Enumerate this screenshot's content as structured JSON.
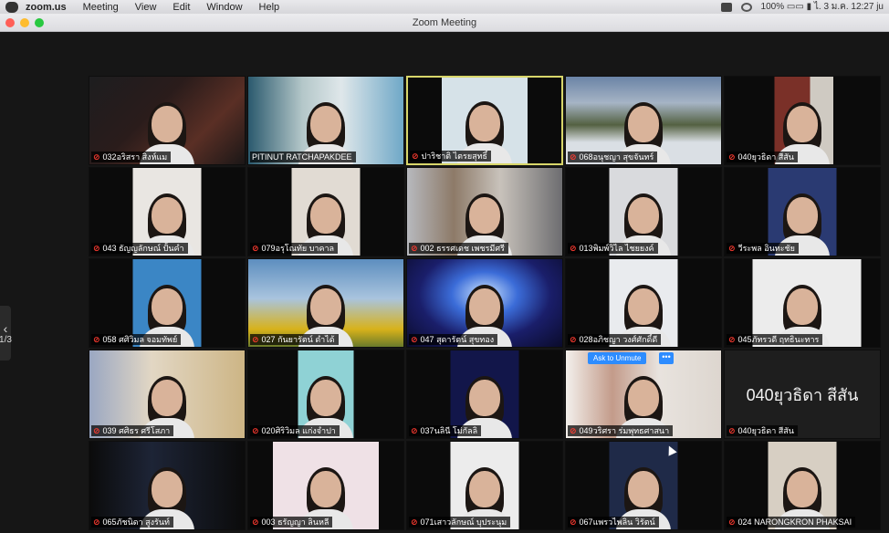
{
  "menubar": {
    "app_name": "zoom.us",
    "items": [
      "Meeting",
      "View",
      "Edit",
      "Window",
      "Help"
    ],
    "status_text": "100% ▭▭  ▮  ไ. 3 ม.ค.  12:27  ju"
  },
  "window": {
    "title": "Zoom Meeting",
    "page_indicator": "1/3"
  },
  "participants": [
    {
      "name": "032อริสรา สิงห์แม",
      "muted": true,
      "type": "video"
    },
    {
      "name": "PITINUT RATCHAPAKDEE",
      "muted": false,
      "type": "video"
    },
    {
      "name": "ปาริชาติ ไตรยสุทธิ์",
      "muted": true,
      "type": "video",
      "active_speaker": true
    },
    {
      "name": "068อนุชญา สุขจันทร์",
      "muted": true,
      "type": "video"
    },
    {
      "name": "040ยุวธิดา สีสัน",
      "muted": true,
      "type": "video"
    },
    {
      "name": "043 ธัญญลักษณ์ ปั้นคำ",
      "muted": true,
      "type": "video"
    },
    {
      "name": "079อรุโณทัย บาคาล",
      "muted": true,
      "type": "video"
    },
    {
      "name": "002 ธรรศเดช เพชรมีศรี",
      "muted": true,
      "type": "video"
    },
    {
      "name": "013พิมพ์วิไล ไชยยงค์",
      "muted": true,
      "type": "video"
    },
    {
      "name": "วีระพล อินทะชัย",
      "muted": true,
      "type": "video"
    },
    {
      "name": "058 ศศิวิมล จอมทัพย์",
      "muted": true,
      "type": "video"
    },
    {
      "name": "027 กันยารัตน์ ดำได้",
      "muted": true,
      "type": "video"
    },
    {
      "name": "047 สุดารัตน์ สุขทอง",
      "muted": true,
      "type": "video"
    },
    {
      "name": "028อภิชญา วงศ์ศักดิ์ดี",
      "muted": true,
      "type": "video"
    },
    {
      "name": "045ภัทรวดี ฤทธินะทาร",
      "muted": true,
      "type": "video"
    },
    {
      "name": "039 ศศิธร ศรีโสภา",
      "muted": true,
      "type": "video"
    },
    {
      "name": "020ศิริวิมล แก่งจำปา",
      "muted": true,
      "type": "video"
    },
    {
      "name": "037นลินี โม่กัลลิ",
      "muted": true,
      "type": "video"
    },
    {
      "name": "049วริศรา ร่มพุทธศาสนา",
      "muted": true,
      "type": "video",
      "hover": true
    },
    {
      "name": "040ยุวธิดา สีสัน",
      "muted": true,
      "type": "name-only",
      "display_name": "040ยุวธิดา สีสัน"
    },
    {
      "name": "065ภัชนิดา สูงรันท์",
      "muted": true,
      "type": "video"
    },
    {
      "name": "003 ธรัญญา ลินหลี",
      "muted": true,
      "type": "video"
    },
    {
      "name": "071เสาวลักษณ์ บุประนุม",
      "muted": true,
      "type": "video"
    },
    {
      "name": "067แพรวไพลิน วิรัตน์",
      "muted": true,
      "type": "video"
    },
    {
      "name": "024 NARONGKRON PHAKSAI",
      "muted": true,
      "type": "video"
    }
  ],
  "hover_controls": {
    "ask_to_unmute_label": "Ask to Unmute",
    "more_label": "•••"
  },
  "colors": {
    "background": "#161616",
    "active_border": "#d8d66a",
    "mute_red": "#ff3b30",
    "zoom_blue": "#2d8cff"
  }
}
